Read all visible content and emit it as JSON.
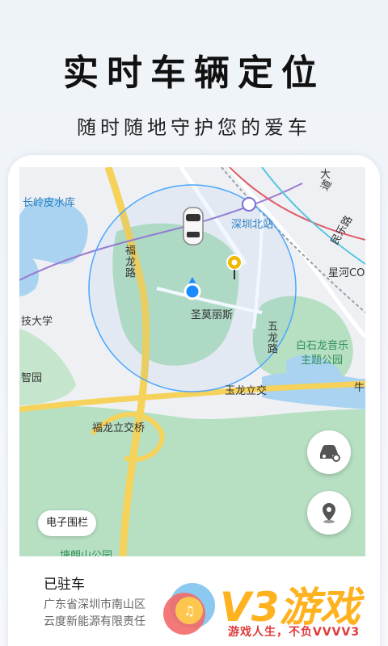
{
  "header": {
    "title": "实时车辆定位",
    "subtitle": "随时随地守护您的爱车"
  },
  "map": {
    "labels": {
      "changling": "长岭皮水库",
      "station": "深圳北站",
      "road_fulong": "福龙路",
      "minle": "民乐路",
      "xinghe": "星河CO",
      "university": "技大学",
      "shengmo": "圣莫丽斯",
      "wulong": "五龙路",
      "baishilong": "白石龙音乐",
      "theme_park": "主题公园",
      "zhiyuan": "智园",
      "yulong": "玉龙立交",
      "niu": "牛",
      "fulong_bridge": "福龙立交桥",
      "tanglang": "塘朗山公园",
      "dao": "道",
      "dao2": "大"
    },
    "fence_button": "电子围栏"
  },
  "card": {
    "status": "已驻车",
    "address_line1": "广东省深圳市南山区",
    "address_line2": "云度新能源有限责任"
  },
  "watermark": {
    "brand": "V3游戏",
    "slogan": "游戏人生，不负VVVV3"
  },
  "colors": {
    "accent_blue": "#1a8cff",
    "pin_yellow": "#f0b800",
    "road_yellow": "#f5d25a",
    "green_area": "#b7dfc2",
    "watermark_orange": "#ffb21f"
  }
}
